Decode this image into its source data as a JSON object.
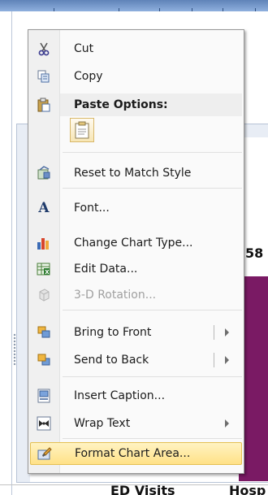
{
  "chart_area": {
    "value_label": "58",
    "category_labels": [
      "ED Visits",
      "Hosp"
    ]
  },
  "menu": {
    "items": [
      {
        "label": "Cut",
        "icon": "scissors-icon"
      },
      {
        "label": "Copy",
        "icon": "copy-icon"
      },
      {
        "label": "Paste Options:",
        "icon": "clipboard-icon"
      },
      {
        "label": "Reset to Match Style",
        "icon": "reset-style-icon"
      },
      {
        "label": "Font...",
        "icon": "font-icon"
      },
      {
        "label": "Change Chart Type...",
        "icon": "bar-chart-icon"
      },
      {
        "label": "Edit Data...",
        "icon": "spreadsheet-icon"
      },
      {
        "label": "3-D Rotation...",
        "icon": "cube-icon"
      },
      {
        "label": "Bring to Front",
        "icon": "bring-front-icon"
      },
      {
        "label": "Send to Back",
        "icon": "send-back-icon"
      },
      {
        "label": "Insert Caption...",
        "icon": "caption-icon"
      },
      {
        "label": "Wrap Text",
        "icon": "wrap-text-icon"
      },
      {
        "label": "Format Chart Area...",
        "icon": "format-area-icon"
      }
    ],
    "paste_option_icon": "paste-keep-formatting-icon"
  },
  "colors": {
    "highlight": "#ffe187",
    "chart_bar": "#7a1a64"
  }
}
